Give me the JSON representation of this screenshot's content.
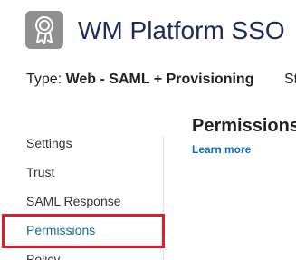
{
  "app": {
    "title": "WM Platform SSO",
    "icon": "award-ribbon-icon"
  },
  "meta": {
    "type_label": "Type:",
    "type_value": "Web - SAML + Provisioning",
    "status_label_partial": "St"
  },
  "sidebar": {
    "items": [
      {
        "label": "Settings"
      },
      {
        "label": "Trust"
      },
      {
        "label": "SAML Response"
      },
      {
        "label": "Permissions",
        "active": true
      },
      {
        "label": "Policy"
      }
    ]
  },
  "main": {
    "section_title": "Permissions",
    "learn_more": "Learn more"
  },
  "colors": {
    "highlight": "#e21b2a",
    "link": "#0b6dc6",
    "active_nav": "#1a6a9a",
    "icon_bg": "#8f8f8f"
  }
}
